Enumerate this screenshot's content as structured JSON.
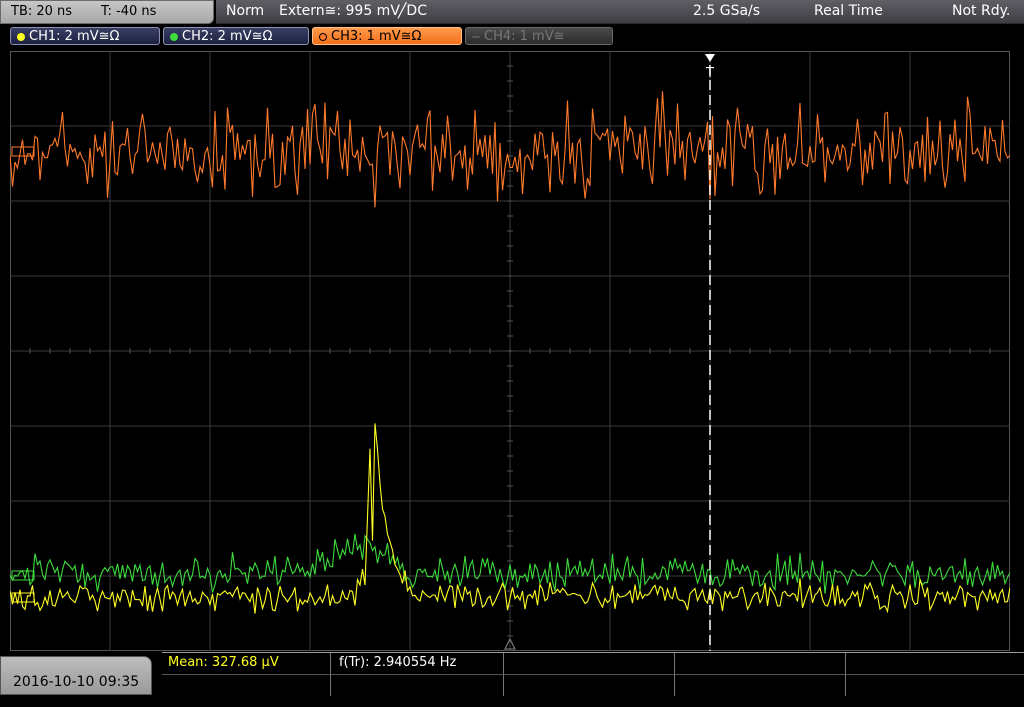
{
  "top": {
    "timebase": "TB: 20 ns",
    "trigger_time": "T: -40 ns",
    "mode": "Norm",
    "trigger_source": "Extern≅: 995 mV",
    "trigger_slope": "╱DC",
    "sample_rate": "2.5 GSa/s",
    "acquisition": "Real Time",
    "state": "Not Rdy."
  },
  "channels": [
    {
      "label": "CH1: 2 mV≅Ω",
      "color": "#ffff22",
      "active": true
    },
    {
      "label": "CH2: 2 mV≅Ω",
      "color": "#3cdc3c",
      "active": true
    },
    {
      "label": "CH3: 1 mV≅Ω",
      "color": "#ff7a2a",
      "active": true
    },
    {
      "label": "CH4: 1 mV≅",
      "color": "#666666",
      "active": false
    }
  ],
  "trigger_marker": "T",
  "bottom": {
    "datetime": "2016-10-10 09:35",
    "mean_label": "Mean: 327.68 µV",
    "freq_label": "f(Tr): 2.940554 Hz"
  },
  "colors": {
    "ch1": "#ffff22",
    "ch2": "#3cdc3c",
    "ch3": "#ff7a2a",
    "grid": "#3a3a3a",
    "meas_text": "#ffff22"
  }
}
